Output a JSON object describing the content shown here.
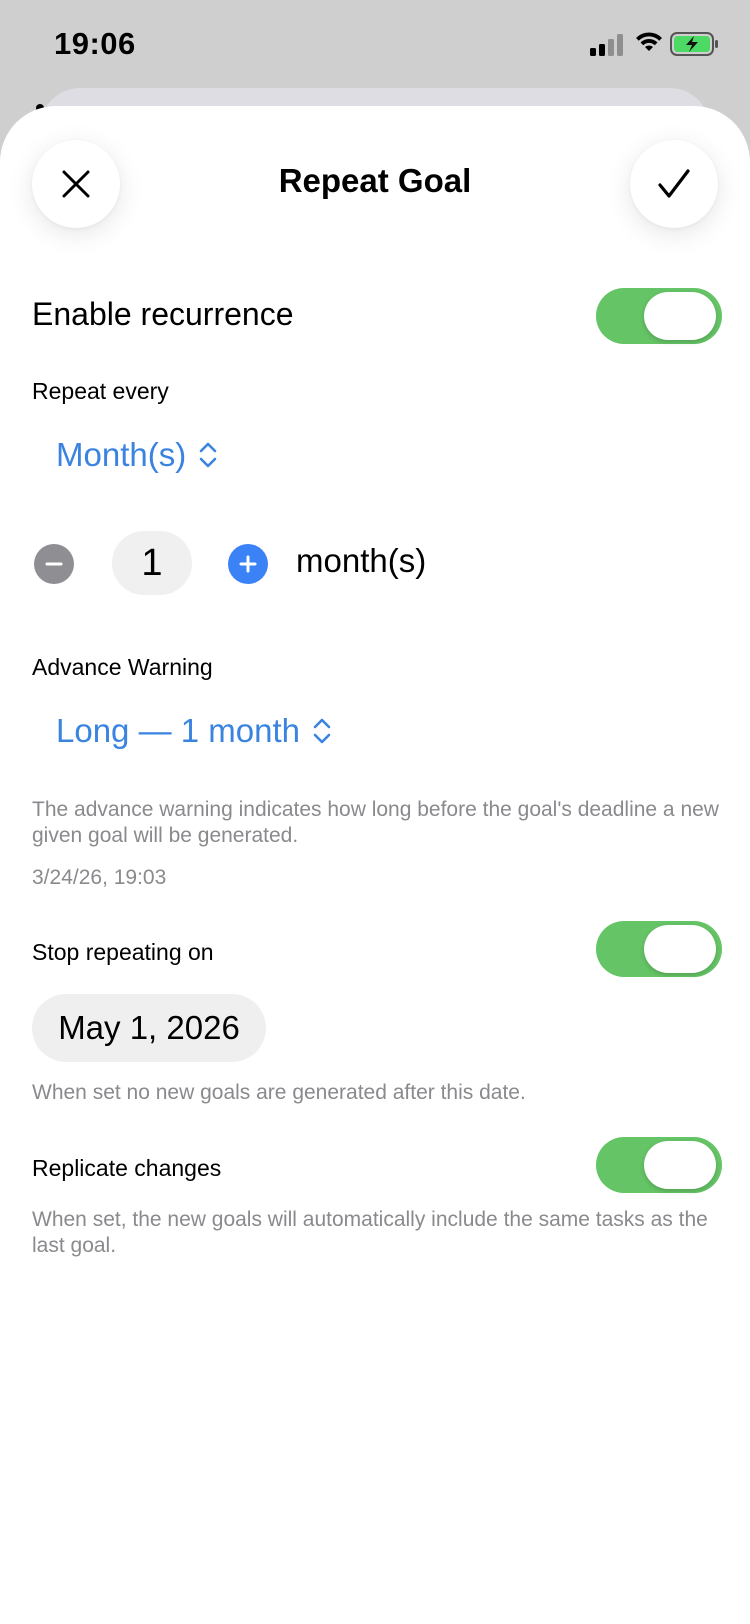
{
  "status": {
    "time": "19:06"
  },
  "header": {
    "title": "Repeat Goal",
    "close_icon": "close-icon",
    "confirm_icon": "checkmark-icon"
  },
  "recurrence": {
    "label": "Enable recurrence",
    "enabled": true
  },
  "repeat_every": {
    "label": "Repeat every",
    "unit_picker": "Month(s)",
    "value": "1",
    "unit_text": "month(s)"
  },
  "advance_warning": {
    "label": "Advance Warning",
    "picker": "Long — 1 month",
    "hint": "The advance warning indicates how long before the goal's deadline a new given goal will be generated.",
    "timestamp": "3/24/26, 19:03"
  },
  "stop_repeating": {
    "label": "Stop repeating on",
    "enabled": true,
    "date": "May 1, 2026",
    "hint": "When set no new goals are generated after this date."
  },
  "replicate": {
    "label": "Replicate changes",
    "enabled": true,
    "hint": "When set,  the new goals will automatically include the same tasks as the last goal."
  },
  "colors": {
    "accent": "#3a84e0",
    "toggle_on": "#65c466",
    "secondary_text": "#8a8a8e"
  }
}
